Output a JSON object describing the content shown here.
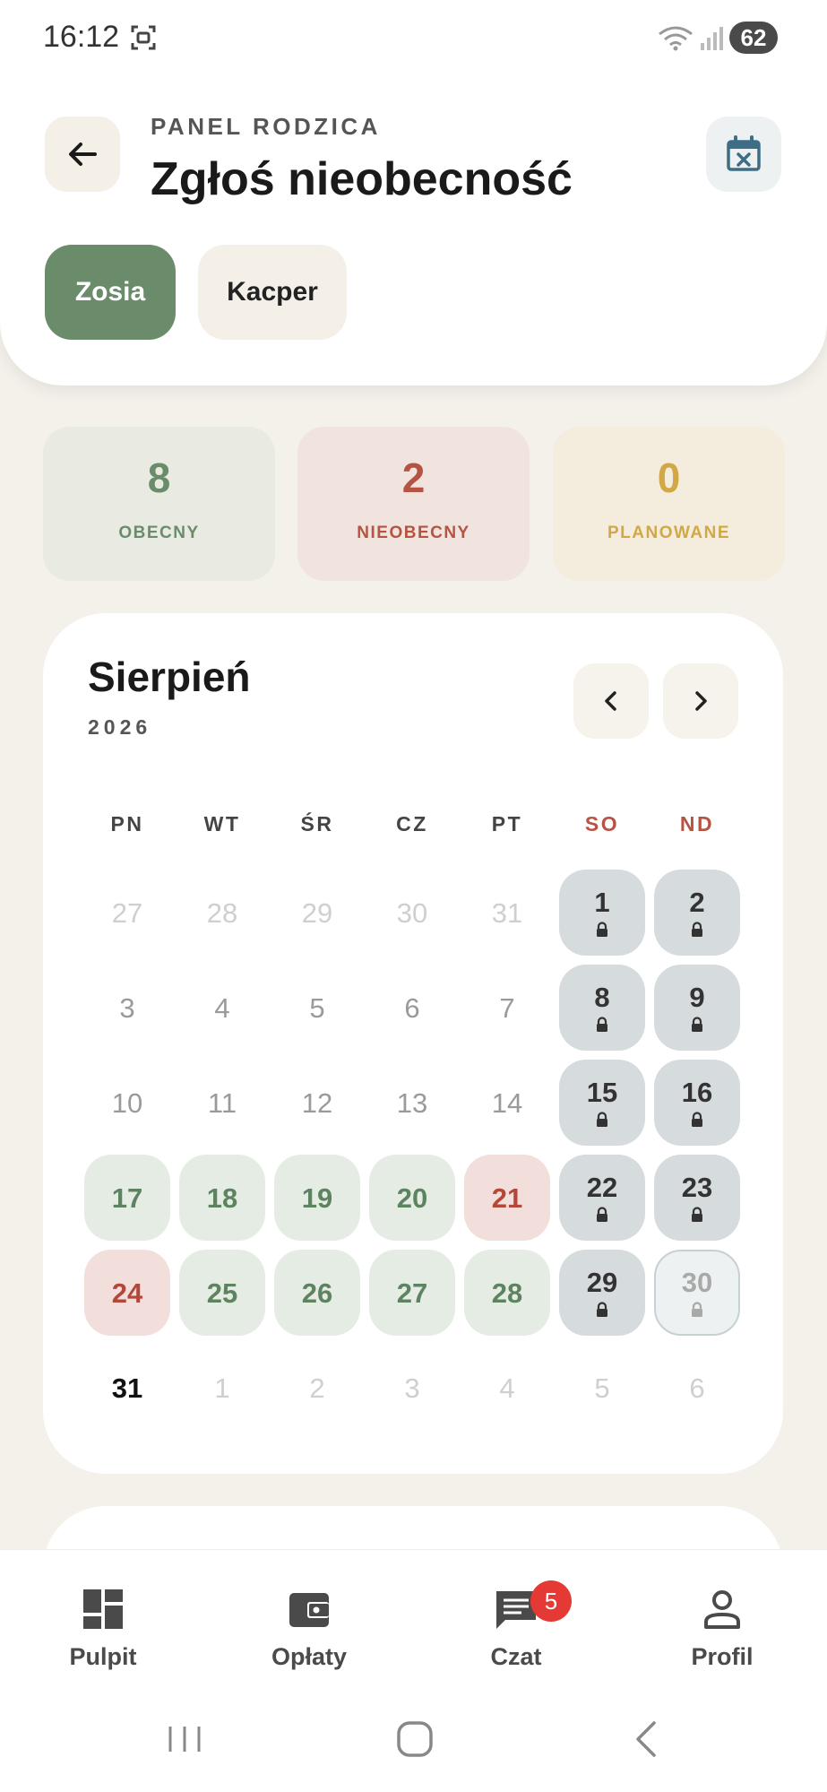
{
  "status": {
    "time": "16:12",
    "battery": "62"
  },
  "header": {
    "eyebrow": "PANEL RODZICA",
    "title": "Zgłoś nieobecność",
    "children": [
      "Zosia",
      "Kacper"
    ],
    "active_child": "Zosia"
  },
  "stats": [
    {
      "value": "8",
      "label": "OBECNY"
    },
    {
      "value": "2",
      "label": "NIEOBECNY"
    },
    {
      "value": "0",
      "label": "PLANOWANE"
    }
  ],
  "calendar": {
    "month": "Sierpień",
    "year": "2026",
    "weekdays": [
      "PN",
      "WT",
      "ŚR",
      "CZ",
      "PT",
      "SO",
      "ND"
    ],
    "weekend_color": "#b55443",
    "weeks": [
      [
        {
          "d": "27",
          "s": "out"
        },
        {
          "d": "28",
          "s": "out"
        },
        {
          "d": "29",
          "s": "out"
        },
        {
          "d": "30",
          "s": "out"
        },
        {
          "d": "31",
          "s": "out"
        },
        {
          "d": "1",
          "s": "locked"
        },
        {
          "d": "2",
          "s": "locked"
        }
      ],
      [
        {
          "d": "3",
          "s": "past"
        },
        {
          "d": "4",
          "s": "past"
        },
        {
          "d": "5",
          "s": "past"
        },
        {
          "d": "6",
          "s": "past"
        },
        {
          "d": "7",
          "s": "past"
        },
        {
          "d": "8",
          "s": "locked"
        },
        {
          "d": "9",
          "s": "locked"
        }
      ],
      [
        {
          "d": "10",
          "s": "past"
        },
        {
          "d": "11",
          "s": "past"
        },
        {
          "d": "12",
          "s": "past"
        },
        {
          "d": "13",
          "s": "past"
        },
        {
          "d": "14",
          "s": "past"
        },
        {
          "d": "15",
          "s": "locked"
        },
        {
          "d": "16",
          "s": "locked"
        }
      ],
      [
        {
          "d": "17",
          "s": "present"
        },
        {
          "d": "18",
          "s": "present"
        },
        {
          "d": "19",
          "s": "present"
        },
        {
          "d": "20",
          "s": "present"
        },
        {
          "d": "21",
          "s": "absent"
        },
        {
          "d": "22",
          "s": "locked"
        },
        {
          "d": "23",
          "s": "locked"
        }
      ],
      [
        {
          "d": "24",
          "s": "absent"
        },
        {
          "d": "25",
          "s": "present"
        },
        {
          "d": "26",
          "s": "present"
        },
        {
          "d": "27",
          "s": "present"
        },
        {
          "d": "28",
          "s": "present"
        },
        {
          "d": "29",
          "s": "locked"
        },
        {
          "d": "30",
          "s": "locked-selected"
        }
      ],
      [
        {
          "d": "31",
          "s": "today"
        },
        {
          "d": "1",
          "s": "out"
        },
        {
          "d": "2",
          "s": "out"
        },
        {
          "d": "3",
          "s": "out"
        },
        {
          "d": "4",
          "s": "out"
        },
        {
          "d": "5",
          "s": "out"
        },
        {
          "d": "6",
          "s": "out"
        }
      ]
    ]
  },
  "bottom_nav": [
    {
      "label": "Pulpit",
      "icon": "dashboard-icon"
    },
    {
      "label": "Opłaty",
      "icon": "wallet-icon"
    },
    {
      "label": "Czat",
      "icon": "chat-icon",
      "badge": "5"
    },
    {
      "label": "Profil",
      "icon": "profile-icon"
    }
  ]
}
